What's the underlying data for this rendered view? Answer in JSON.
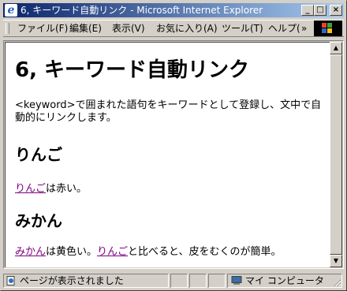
{
  "window": {
    "title": "6, キーワード自動リンク - Microsoft Internet Explorer",
    "title_icon": "e",
    "controls": {
      "minimize": "_",
      "maximize": "□",
      "close": "×"
    }
  },
  "menu": {
    "items": [
      "ファイル(F)",
      "編集(E)",
      "表示(V)",
      "お気に入り(A)",
      "ツール(T)",
      "ヘルプ("
    ],
    "more": "»"
  },
  "page": {
    "title": "6, キーワード自動リンク",
    "intro": "<keyword>で囲まれた語句をキーワードとして登録し、文中で自動的にリンクします。",
    "sections": [
      {
        "heading": "りんご",
        "paragraph": {
          "link": "りんご",
          "text": "は赤い。"
        }
      },
      {
        "heading": "みかん",
        "paragraph": {
          "link1": "みかん",
          "text1": "は黄色い。",
          "link2": "りんご",
          "text2": "と比べると、皮をむくのが簡単。"
        }
      }
    ]
  },
  "status": {
    "text": "ページが表示されました",
    "zone": "マイ コンピュータ"
  },
  "colors": {
    "visited_link": "#800080",
    "title_bar_start": "#0a246a",
    "title_bar_end": "#a6caf0"
  }
}
